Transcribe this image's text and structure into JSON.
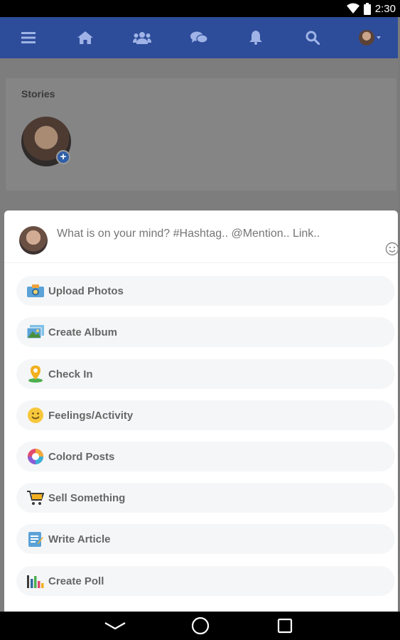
{
  "status_bar": {
    "time": "2:30",
    "icons": [
      "wifi-icon",
      "battery-icon"
    ]
  },
  "nav": {
    "items": [
      {
        "name": "menu-icon"
      },
      {
        "name": "home-icon"
      },
      {
        "name": "friends-icon"
      },
      {
        "name": "messages-icon"
      },
      {
        "name": "notifications-icon"
      },
      {
        "name": "search-icon"
      },
      {
        "name": "profile-avatar"
      }
    ],
    "bg_color": "#2d4c9a"
  },
  "stories": {
    "title": "Stories"
  },
  "composer": {
    "placeholder": "What is on your mind? #Hashtag.. @Mention.. Link.."
  },
  "options": [
    {
      "label": "Upload Photos",
      "icon": "camera-icon"
    },
    {
      "label": "Create Album",
      "icon": "album-icon"
    },
    {
      "label": "Check In",
      "icon": "location-pin-icon"
    },
    {
      "label": "Feelings/Activity",
      "icon": "smiley-icon"
    },
    {
      "label": "Colord Posts",
      "icon": "color-wheel-icon"
    },
    {
      "label": "Sell Something",
      "icon": "shopping-cart-icon"
    },
    {
      "label": "Write Article",
      "icon": "article-icon"
    },
    {
      "label": "Create Poll",
      "icon": "poll-chart-icon"
    }
  ],
  "system_nav": [
    "back-icon",
    "home-circle-icon",
    "recents-icon"
  ]
}
